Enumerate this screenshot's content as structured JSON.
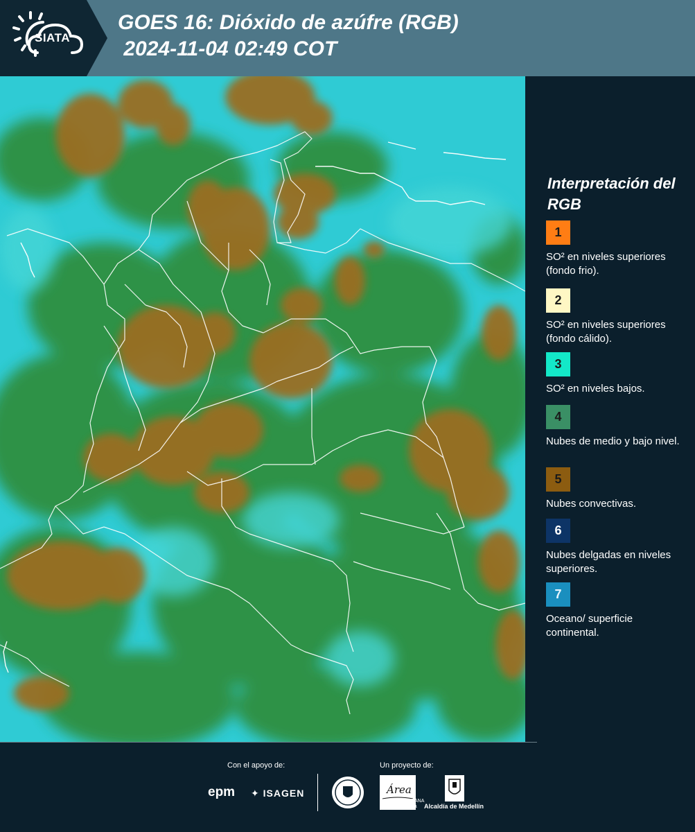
{
  "header": {
    "logo_text": "SIATA",
    "title": "GOES 16: Dióxido de azúfre (RGB)\n 2024-11-04 02:49 COT"
  },
  "legend": {
    "title": "Interpretación del RGB",
    "items": [
      {
        "number": "1",
        "color": "#ff7d14",
        "text": "SO² en niveles superiores (fondo frio)."
      },
      {
        "number": "2",
        "color": "#fff7c4",
        "text": "SO² en niveles superiores (fondo cálido)."
      },
      {
        "number": "3",
        "color": "#13e8c8",
        "text": "SO² en niveles bajos."
      },
      {
        "number": "4",
        "color": "#3a8f65",
        "text": "Nubes de medio y bajo nivel."
      },
      {
        "number": "5",
        "color": "#8c5c10",
        "text": "Nubes convectivas."
      },
      {
        "number": "6",
        "color": "#0d3466",
        "text": "Nubes delgadas en niveles superiores."
      },
      {
        "number": "7",
        "color": "#1a8fbf",
        "text": "Oceano/ superficie continental."
      }
    ]
  },
  "footer": {
    "support_label": "Con el apoyo de:",
    "project_label": "Un proyecto de:",
    "epm": "epm",
    "isagen": "ISAGEN",
    "area_logo": "Área",
    "area_sub": "METROPOLITANA Valle de Aburrá",
    "alcaldia": "Alcaldía de Medellín"
  },
  "colors": {
    "header_bg": "#4e7788",
    "panel_bg": "#0b1f2c",
    "map_cyan": "#2fcbd4",
    "map_green": "#2f8f3f",
    "map_brown": "#8a6a1e"
  }
}
